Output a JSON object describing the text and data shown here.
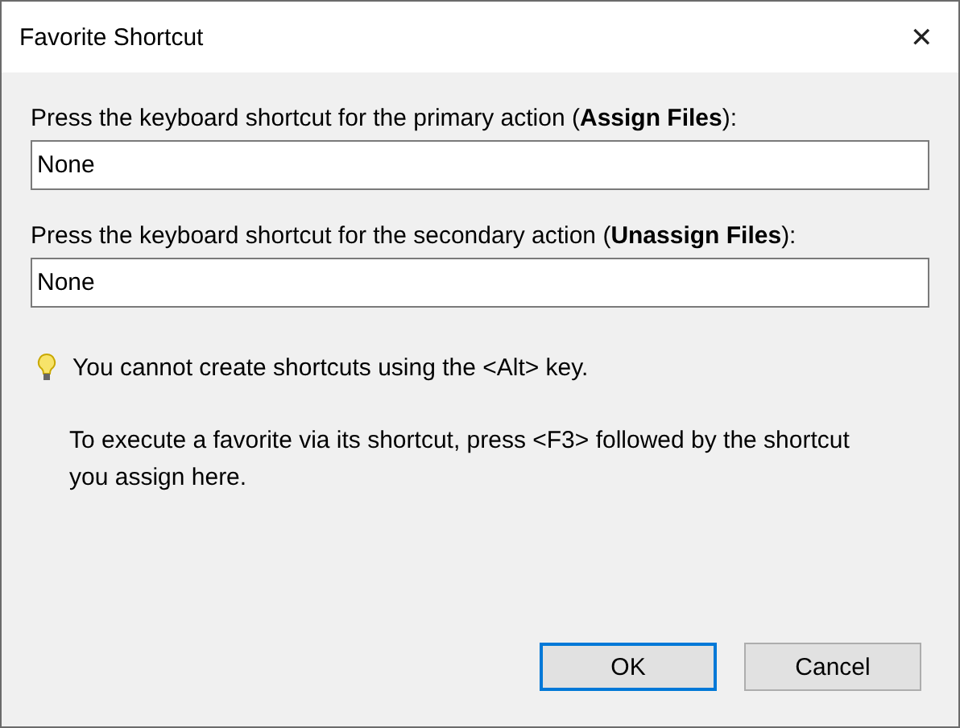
{
  "window": {
    "title": "Favorite Shortcut",
    "close": "✕"
  },
  "fields": [
    {
      "label": "Press the keyboard shortcut for the primary action (**Assign Files**):",
      "value": "None"
    },
    {
      "label": "Press the keyboard shortcut for the secondary action (**Unassign Files**):",
      "value": "None"
    }
  ],
  "tip": "You cannot create shortcuts using the <Alt> key.",
  "note": "To execute a favorite via its shortcut, press <F3> followed by the shortcut you assign here.",
  "buttons": [
    {
      "label": "OK",
      "default": true
    },
    {
      "label": "Cancel",
      "default": false
    }
  ]
}
